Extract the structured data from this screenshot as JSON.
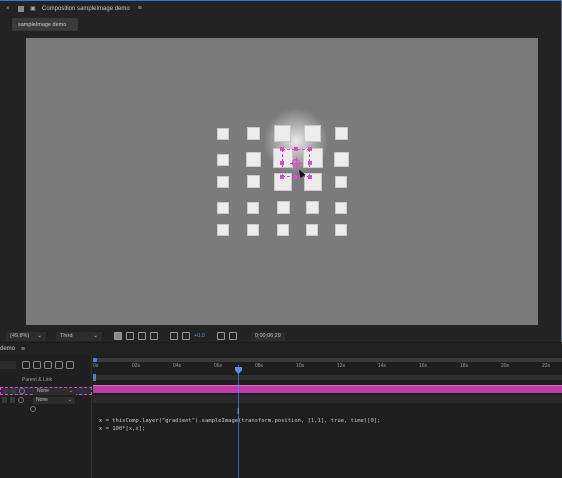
{
  "composition_panel": {
    "title": "Composition sampleImage demo",
    "tab_label": "sampleImage demo"
  },
  "viewer_bar": {
    "zoom": "(49.8%)",
    "resolution": "Third",
    "exposure": "+0.0",
    "timecode": "0;00;06;29"
  },
  "timeline": {
    "tab_label": "demo",
    "column_header": "Parent & Link",
    "layers": [
      {
        "parent": "None"
      },
      {
        "parent": "None"
      }
    ],
    "ruler_ticks": [
      "0s",
      "02s",
      "04s",
      "06s",
      "08s",
      "10s",
      "12s",
      "14s",
      "16s",
      "18s",
      "20s",
      "22s"
    ],
    "expression_lines": [
      "x = thisComp.layer(\"gradient\").sampleImage(transform.position, [1,1], true, time)[0];",
      "x = 100*[x,x];"
    ]
  },
  "colors": {
    "accent_blue": "#3d6fd8",
    "layer_bar": "#c13aa8",
    "selection": "#d44ec4",
    "viewer_bg": "#7b7b7b"
  }
}
